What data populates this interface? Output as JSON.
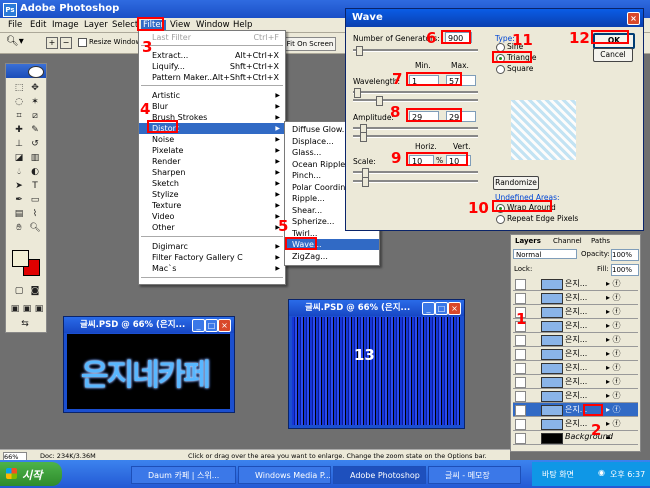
{
  "app": {
    "title": "Adobe Photoshop",
    "menu": [
      "File",
      "Edit",
      "Image",
      "Layer",
      "Select",
      "Filter",
      "View",
      "Window",
      "Help"
    ],
    "options": {
      "resize_windows": "Resize Windows T",
      "fit_on_screen": "Fit On Screen"
    }
  },
  "filter_menu": {
    "items": [
      {
        "label": "Last Filter",
        "shortcut": "Ctrl+F",
        "disabled": true
      },
      {
        "label": "Extract...",
        "shortcut": "Alt+Ctrl+X"
      },
      {
        "label": "Liquify...",
        "shortcut": "Shft+Ctrl+X"
      },
      {
        "label": "Pattern Maker...",
        "shortcut": "Alt+Shft+Ctrl+X"
      },
      {
        "label": "Artistic"
      },
      {
        "label": "Blur"
      },
      {
        "label": "Brush Strokes"
      },
      {
        "label": "Distort",
        "highlighted": true
      },
      {
        "label": "Noise"
      },
      {
        "label": "Pixelate"
      },
      {
        "label": "Render"
      },
      {
        "label": "Sharpen"
      },
      {
        "label": "Sketch"
      },
      {
        "label": "Stylize"
      },
      {
        "label": "Texture"
      },
      {
        "label": "Video"
      },
      {
        "label": "Other"
      },
      {
        "label": "Digimarc"
      },
      {
        "label": "Filter Factory Gallery C"
      },
      {
        "label": "Mac`s"
      }
    ]
  },
  "distort_menu": {
    "items": [
      "Diffuse Glow...",
      "Displace...",
      "Glass...",
      "Ocean Ripple...",
      "Pinch...",
      "Polar Coordinates...",
      "Ripple...",
      "Shear...",
      "Spherize...",
      "Twirl...",
      "Wave...",
      "ZigZag..."
    ],
    "selected": "Wave..."
  },
  "wave_dialog": {
    "title": "Wave",
    "generators_label": "Number of Generators:",
    "generators_value": "900",
    "min_label": "Min.",
    "max_label": "Max.",
    "wavelength_label": "Wavelength:",
    "wavelength_min": "1",
    "wavelength_max": "57",
    "amplitude_label": "Amplitude:",
    "amplitude_min": "29",
    "amplitude_max": "29",
    "horiz_label": "Horiz.",
    "vert_label": "Vert.",
    "scale_label": "Scale:",
    "scale_h": "10",
    "scale_v": "10",
    "pct": "%",
    "type_label": "Type:",
    "type_options": [
      "Sine",
      "Triangle",
      "Square"
    ],
    "type_selected": "Triangle",
    "ok": "OK",
    "cancel": "Cancel",
    "randomize": "Randomize",
    "undefined_areas_label": "Undefined Areas:",
    "wrap_around": "Wrap Around",
    "repeat_edge": "Repeat Edge Pixels"
  },
  "layers_panel": {
    "tabs": [
      "Layers",
      "Channel",
      "Paths"
    ],
    "blend_mode": "Normal",
    "opacity_label": "Opacity:",
    "opacity": "100%",
    "lock_label": "Lock:",
    "fill_label": "Fill:",
    "fill": "100%",
    "layers": [
      "은지...",
      "은지...",
      "은지...",
      "은지...",
      "은지...",
      "은지...",
      "은지...",
      "은지...",
      "은지...",
      "은지...",
      "은지..."
    ],
    "selected_layer": "은지...",
    "background": "Background"
  },
  "doc_windows": [
    {
      "title": "글씨.PSD @ 66% (은지...",
      "text": "은지네카페"
    },
    {
      "title": "글씨.PSD @ 66% (은지..."
    }
  ],
  "statusbar": {
    "zoom": "66%",
    "doc": "Doc: 234K/3.36M",
    "hint": "Click or drag over the area you want to enlarge. Change the zoom state on the Options bar."
  },
  "taskbar": {
    "start": "시작",
    "tasks": [
      "Daum 카페 | 스위...",
      "Windows Media P...",
      "Adobe Photoshop",
      "글씨 - 메모장"
    ],
    "tray_text": "바탕 화면",
    "clock": "오후 6:37"
  },
  "annotations": [
    "1",
    "2",
    "3",
    "4",
    "5",
    "6",
    "7",
    "8",
    "9",
    "10",
    "11",
    "12",
    "13"
  ],
  "colors": {
    "highlight": "#316ac5",
    "annotation": "#ff0000",
    "xp_blue": "#2359d4"
  }
}
